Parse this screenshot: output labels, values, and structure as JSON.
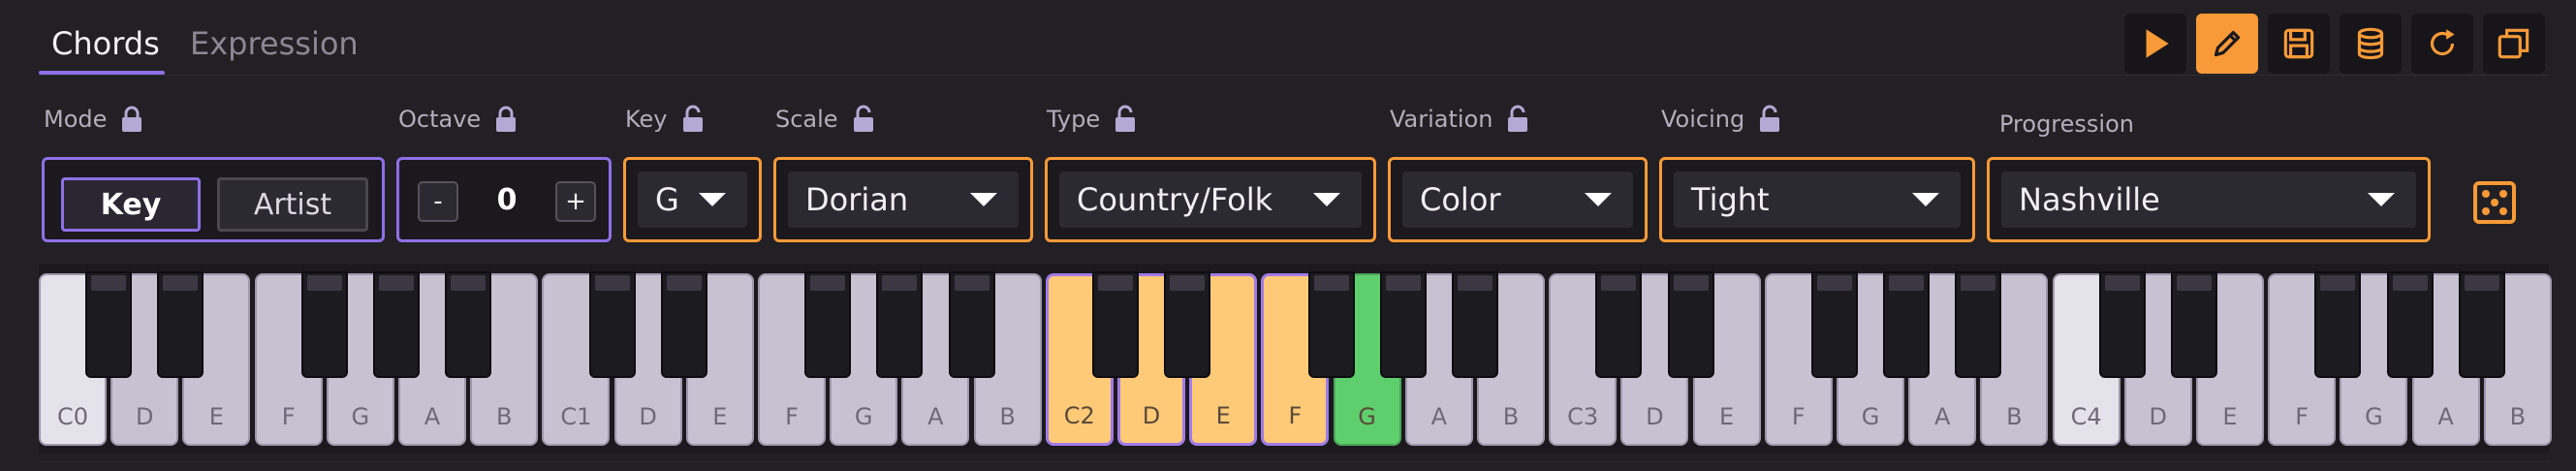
{
  "tabs": [
    {
      "label": "Chords",
      "active": true
    },
    {
      "label": "Expression",
      "active": false
    }
  ],
  "toolbar": {
    "buttons": [
      {
        "icon": "play-icon",
        "active": false
      },
      {
        "icon": "pencil-icon",
        "active": true
      },
      {
        "icon": "save-icon",
        "active": false
      },
      {
        "icon": "database-icon",
        "active": false
      },
      {
        "icon": "refresh-icon",
        "active": false
      },
      {
        "icon": "copy-icon",
        "active": false
      }
    ]
  },
  "labels": {
    "mode": "Mode",
    "octave": "Octave",
    "key": "Key",
    "scale": "Scale",
    "type": "Type",
    "variation": "Variation",
    "voicing": "Voicing",
    "progression": "Progression"
  },
  "mode": {
    "options": [
      "Key",
      "Artist"
    ],
    "selected": "Key"
  },
  "octave": {
    "minus": "-",
    "value": "0",
    "plus": "+"
  },
  "dropdowns": {
    "key": "G",
    "scale": "Dorian",
    "type": "Country/Folk",
    "variation": "Color",
    "voicing": "Tight",
    "progression": "Nashville"
  },
  "colors": {
    "accent_purple": "#8f70e8",
    "accent_orange": "#f79a37",
    "highlight_key": "#ffca78",
    "root_key": "#5fcf6e",
    "background": "#222024"
  },
  "keyboard": {
    "white_keys": [
      "C0",
      "D",
      "E",
      "F",
      "G",
      "A",
      "B",
      "C1",
      "D",
      "E",
      "F",
      "G",
      "A",
      "B",
      "C2",
      "D",
      "E",
      "F",
      "G",
      "A",
      "B",
      "C3",
      "D",
      "E",
      "F",
      "G",
      "A",
      "B",
      "C4",
      "D",
      "E",
      "F",
      "G",
      "A",
      "B"
    ],
    "highlighted": [
      "C2",
      "D",
      "E",
      "F"
    ],
    "root": "G"
  }
}
